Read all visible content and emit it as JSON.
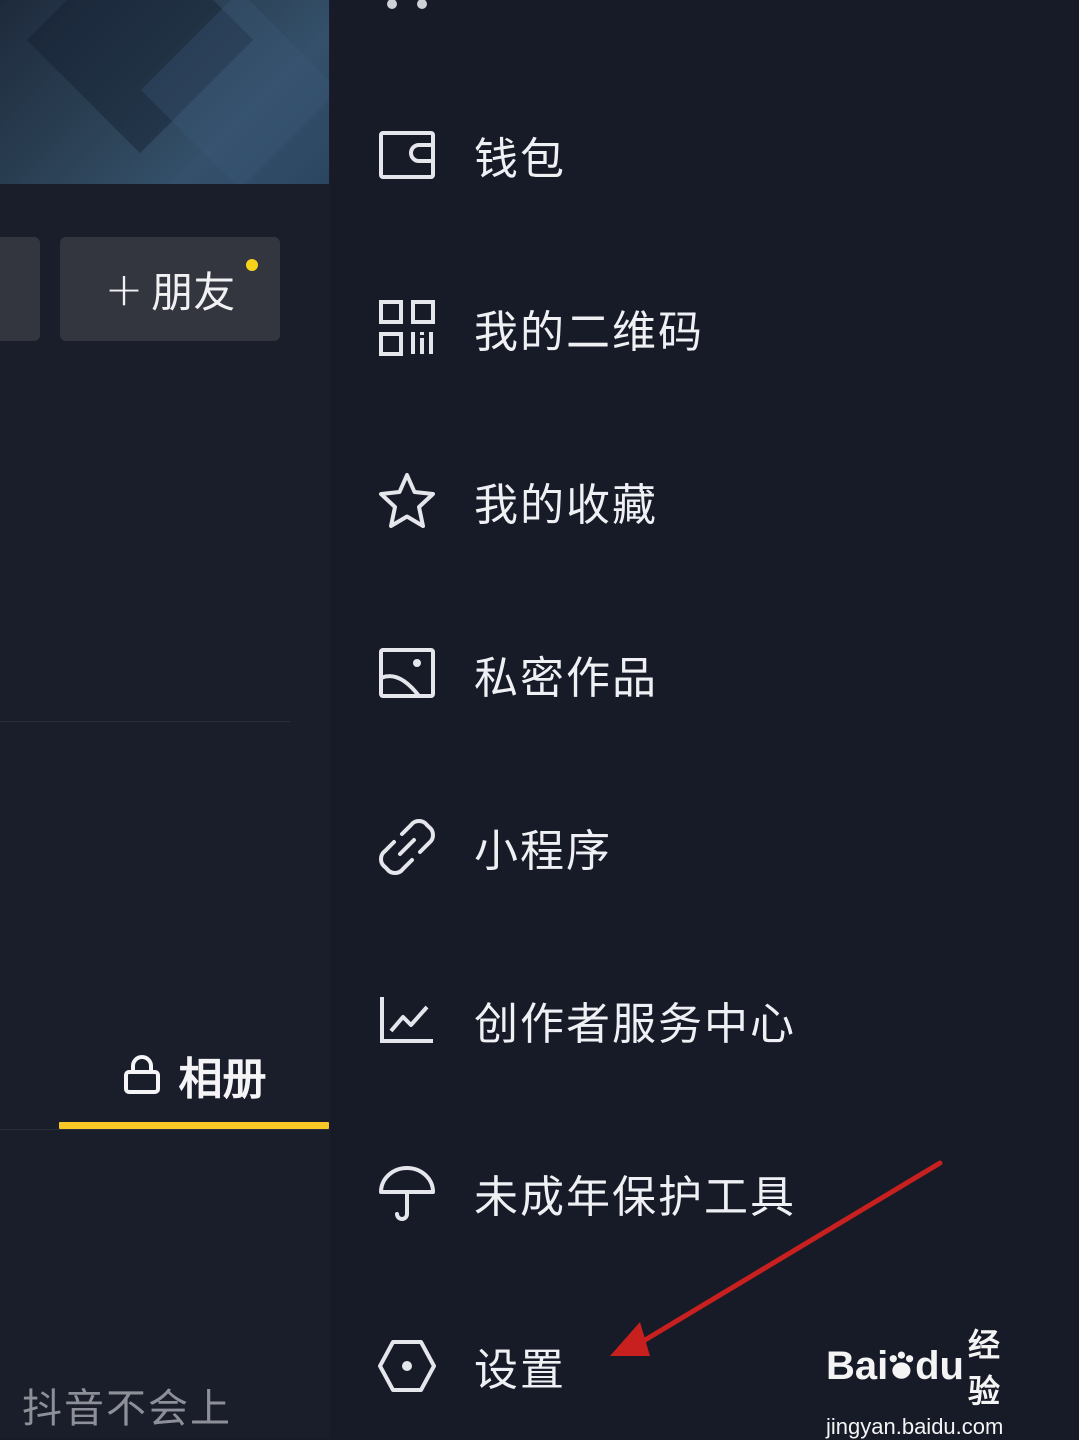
{
  "left": {
    "add_friend_label": "朋友",
    "add_friend_plus": "+",
    "album_tab": "相册",
    "caption": "抖音不会上"
  },
  "menu": [
    {
      "label": "钱包",
      "icon": "wallet-icon"
    },
    {
      "label": "我的二维码",
      "icon": "qr-code-icon"
    },
    {
      "label": "我的收藏",
      "icon": "star-icon"
    },
    {
      "label": "私密作品",
      "icon": "image-icon"
    },
    {
      "label": "小程序",
      "icon": "link-icon"
    },
    {
      "label": "创作者服务中心",
      "icon": "chart-icon"
    },
    {
      "label": "未成年保护工具",
      "icon": "umbrella-icon"
    },
    {
      "label": "设置",
      "icon": "settings-hexagon-icon"
    }
  ],
  "watermark": {
    "brand": "Bai",
    "brand_suffix": "du",
    "brand_cn": "经验",
    "url": "jingyan.baidu.com"
  },
  "colors": {
    "background": "#171a27",
    "accent_yellow": "#f7c825",
    "arrow_red": "#c8201f"
  }
}
